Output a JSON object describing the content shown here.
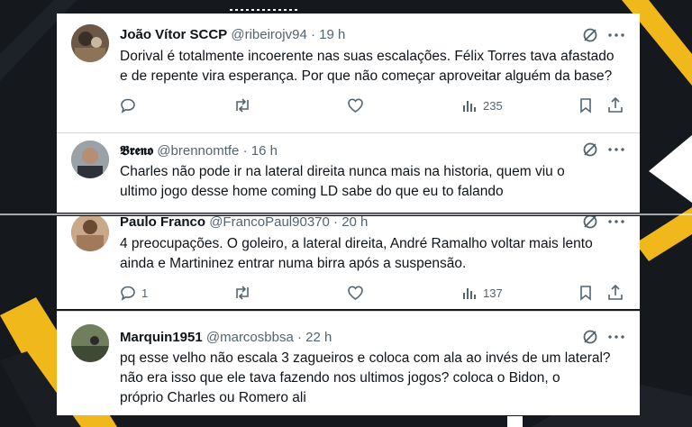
{
  "colors": {
    "accent_yellow": "#f5c518",
    "text": "#0f1419",
    "muted": "#536471",
    "background": "#14171c"
  },
  "tweets": [
    {
      "name": "João Vítor SCCP",
      "handle": "@ribeirojv94",
      "dot": "·",
      "time": "19 h",
      "text": "Dorival é totalmente incoerente nas suas escalações. Félix Torres tava afastado\ne de repente vira esperança. Por que não começar aproveitar alguém da base?",
      "replies": "",
      "retweets": "",
      "likes": "",
      "views": "235"
    },
    {
      "name": "𝕭𝖗𝖊𝖓𝖔",
      "handle": "@brennomtfe",
      "dot": "·",
      "time": "16 h",
      "text": "Charles não pode ir na lateral direita nunca mais na historia, quem viu o\nultimo jogo desse home coming LD sabe do que eu to falando"
    },
    {
      "name": "Paulo Franco",
      "handle": "@FrancoPaul90370",
      "dot": "·",
      "time": "20 h",
      "text": "4 preocupações.  O goleiro, a lateral direita, André Ramalho voltar mais lento\nainda e Martininez entrar numa birra após a suspensão.",
      "replies": "1",
      "retweets": "",
      "likes": "",
      "views": "137"
    },
    {
      "name": "Marquin1951",
      "handle": "@marcosbbsa",
      "dot": "·",
      "time": "22 h",
      "text": "pq esse velho não escala 3 zagueiros e coloca com ala ao invés de um lateral?\nnão era isso que ele tava fazendo nos ultimos jogos? coloca o Bidon, o\npróprio Charles  ou Romero ali"
    }
  ],
  "icons": {
    "grok": "grok-icon",
    "more": "more-icon",
    "reply": "reply-icon",
    "retweet": "retweet-icon",
    "like": "like-icon",
    "views": "views-icon",
    "bookmark": "bookmark-icon",
    "share": "share-icon"
  }
}
